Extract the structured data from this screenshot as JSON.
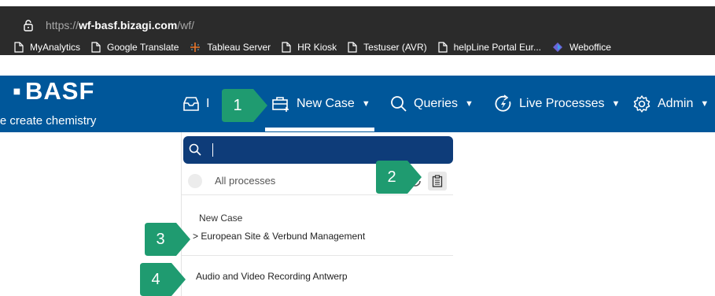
{
  "url": {
    "scheme": "https://",
    "host": "wf-basf.bizagi.com",
    "path": "/wf/"
  },
  "bookmarks": [
    {
      "label": "MyAnalytics",
      "icon": "page-icon"
    },
    {
      "label": "Google Translate",
      "icon": "page-icon"
    },
    {
      "label": "Tableau Server",
      "icon": "tableau-icon"
    },
    {
      "label": "HR Kiosk",
      "icon": "page-icon"
    },
    {
      "label": "Testuser (AVR)",
      "icon": "page-icon"
    },
    {
      "label": "helpLine Portal Eur...",
      "icon": "page-icon"
    },
    {
      "label": "Weboffice",
      "icon": "weboffice-icon"
    }
  ],
  "brand": {
    "name": "BASF",
    "tagline": "We create chemistry"
  },
  "nav": {
    "inbox": "I",
    "new_case": "New Case",
    "queries": "Queries",
    "live_processes": "Live Processes",
    "admin": "Admin"
  },
  "dropdown": {
    "search_value": "",
    "filter_label": "All processes",
    "section_title": "New Case",
    "items": [
      "> European Site & Verbund Management",
      "Audio and Video Recording Antwerp"
    ]
  },
  "markers": [
    "1",
    "2",
    "3",
    "4"
  ],
  "colors": {
    "brand_blue": "#00579a",
    "search_blue": "#0e3c79",
    "marker_green": "#1f9b70",
    "browser_dark": "#2b2b2b"
  }
}
